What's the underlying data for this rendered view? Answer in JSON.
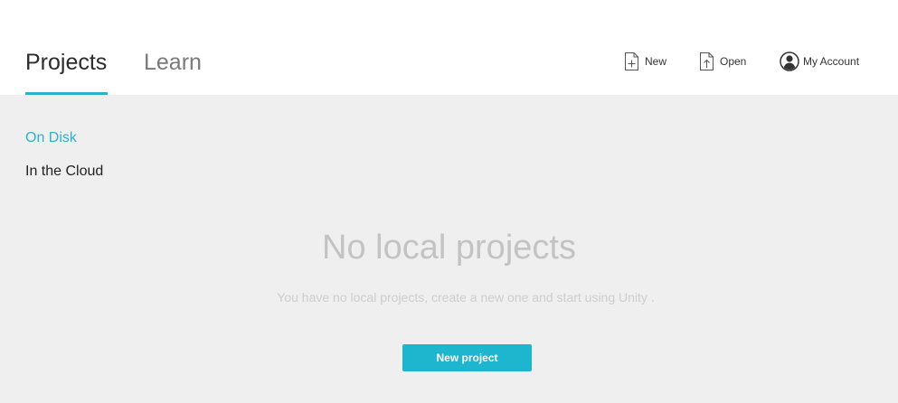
{
  "header": {
    "tabs": [
      {
        "label": "Projects",
        "active": true
      },
      {
        "label": "Learn",
        "active": false
      }
    ],
    "actions": {
      "new_label": "New",
      "open_label": "Open",
      "account_label": "My Account"
    }
  },
  "sidebar": {
    "items": [
      {
        "label": "On Disk",
        "active": true
      },
      {
        "label": "In the Cloud",
        "active": false
      }
    ]
  },
  "empty_state": {
    "title": "No local projects",
    "description": "You have no local projects, create a new one and start using Unity .",
    "button_label": "New project"
  },
  "colors": {
    "accent": "#2fb2c9",
    "button": "#1eb5cf",
    "content_background": "#efefef"
  },
  "icons": [
    "new-file-icon",
    "open-file-icon",
    "account-icon"
  ]
}
